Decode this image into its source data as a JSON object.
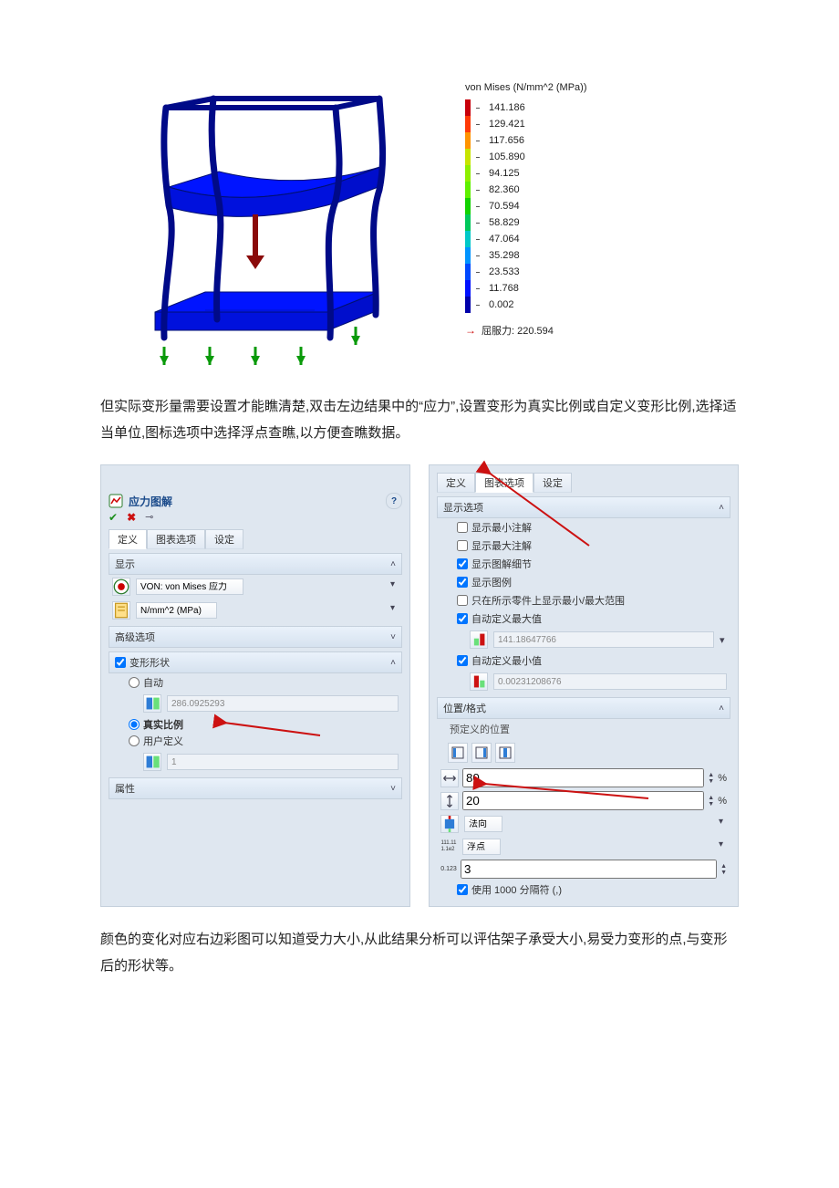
{
  "fig1": {
    "legend_title": "von Mises (N/mm^2 (MPa))",
    "legend_values": [
      "141.186",
      "129.421",
      "117.656",
      "105.890",
      "94.125",
      "82.360",
      "70.594",
      "58.829",
      "47.064",
      "35.298",
      "23.533",
      "11.768",
      "0.002"
    ],
    "legend_colors": [
      "#c8000b",
      "#ff3a07",
      "#ff9400",
      "#c7e400",
      "#8eef00",
      "#5ff000",
      "#12d200",
      "#00c85b",
      "#00c8c8",
      "#0094ff",
      "#0049ff",
      "#0011ff",
      "#0000aa"
    ],
    "yield_label": "屈服力: 220.594"
  },
  "para1": "但实际变形量需要设置才能瞧清楚,双击左边结果中的“应力”,设置变形为真实比例或自定义变形比例,选择适当单位,图标选项中选择浮点查瞧,以方便查瞧数据。",
  "left_panel": {
    "title": "应力图解",
    "tabs": {
      "definition": "定义",
      "chart_options": "图表选项",
      "settings": "设定"
    },
    "display_section": "显示",
    "von": "VON: von Mises 应力",
    "unit": "N/mm^2 (MPa)",
    "advanced": "高级选项",
    "deform_section": "变形形状",
    "auto": "自动",
    "auto_value": "286.0925293",
    "true_scale": "真实比例",
    "user_def": "用户定义",
    "user_val": "1",
    "properties": "属性"
  },
  "right_panel": {
    "tabs": {
      "definition": "定义",
      "chart_options": "图表选项",
      "settings": "设定"
    },
    "display_options": "显示选项",
    "show_min": "显示最小注解",
    "show_max": "显示最大注解",
    "show_detail": "显示图解细节",
    "show_legend": "显示图例",
    "only_range": "只在所示零件上显示最小/最大范围",
    "auto_max": "自动定义最大值",
    "auto_max_val": "141.18647766",
    "auto_min": "自动定义最小值",
    "auto_min_val": "0.00231208676",
    "pos_format": "位置/格式",
    "predef_pos": "预定义的位置",
    "width_pct": "80",
    "height_pct": "20",
    "percent": "%",
    "orientation": "法向",
    "floating": "浮点",
    "decimals": "3",
    "use_sep": "使用 1000 分隔符 (,)"
  },
  "para2": "颜色的变化对应右边彩图可以知道受力大小,从此结果分析可以评估架子承受大小,易受力变形的点,与变形后的形状等。"
}
